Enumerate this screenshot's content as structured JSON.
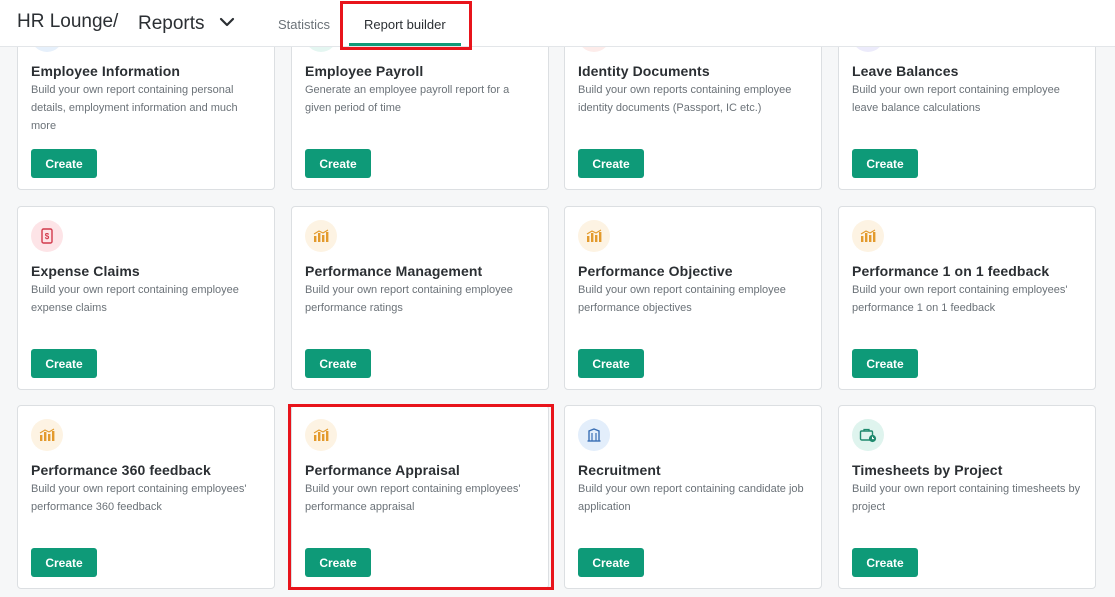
{
  "header": {
    "breadcrumb_root": "HR Lounge",
    "separator": "/",
    "page_title": "Reports",
    "tabs": [
      {
        "label": "Statistics"
      },
      {
        "label": "Report builder"
      }
    ]
  },
  "colors": {
    "accent": "#0e9a78",
    "highlight": "#e8141b"
  },
  "cards": [
    {
      "title": "Employee Information",
      "desc": "Build your own report containing personal details, employment information and much more",
      "button": "Create",
      "icon": "user-icon",
      "icon_bg": "#e6f0fb"
    },
    {
      "title": "Employee Payroll",
      "desc": "Generate an employee payroll report for a given period of time",
      "button": "Create",
      "icon": "payroll-icon",
      "icon_bg": "#e4f6f1"
    },
    {
      "title": "Identity Documents",
      "desc": "Build your own reports containing employee identity documents (Passport, IC etc.)",
      "button": "Create",
      "icon": "id-card-icon",
      "icon_bg": "#fdecea"
    },
    {
      "title": "Leave Balances",
      "desc": "Build your own report containing employee leave balance calculations",
      "button": "Create",
      "icon": "calendar-icon",
      "icon_bg": "#ecebfb"
    },
    {
      "title": "Expense Claims",
      "desc": "Build your own report containing employee expense claims",
      "button": "Create",
      "icon": "receipt-icon",
      "icon_bg": "#fde4e7"
    },
    {
      "title": "Performance Management",
      "desc": "Build your own report containing employee performance ratings",
      "button": "Create",
      "icon": "chart-icon",
      "icon_bg": "#fdf3e3"
    },
    {
      "title": "Performance Objective",
      "desc": "Build your own report containing employee performance objectives",
      "button": "Create",
      "icon": "chart-icon",
      "icon_bg": "#fdf3e3"
    },
    {
      "title": "Performance 1 on 1 feedback",
      "desc": "Build your own report containing employees' performance 1 on 1 feedback",
      "button": "Create",
      "icon": "chart-icon",
      "icon_bg": "#fdf3e3"
    },
    {
      "title": "Performance 360 feedback",
      "desc": "Build your own report containing employees' performance 360 feedback",
      "button": "Create",
      "icon": "chart-icon",
      "icon_bg": "#fdf3e3"
    },
    {
      "title": "Performance Appraisal",
      "desc": "Build your own report containing employees' performance appraisal",
      "button": "Create",
      "icon": "chart-icon",
      "icon_bg": "#fdf3e3"
    },
    {
      "title": "Recruitment",
      "desc": "Build your own report containing candidate job application",
      "button": "Create",
      "icon": "building-icon",
      "icon_bg": "#e3eefb"
    },
    {
      "title": "Timesheets by Project",
      "desc": "Build your own report containing timesheets by project",
      "button": "Create",
      "icon": "briefcase-clock-icon",
      "icon_bg": "#dff4ee"
    }
  ]
}
